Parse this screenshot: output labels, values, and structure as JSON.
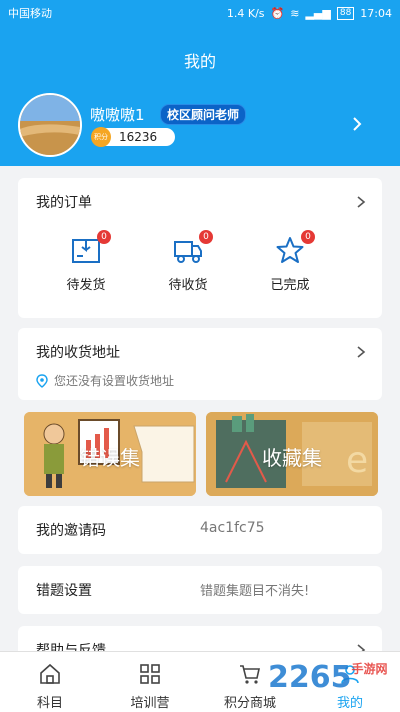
{
  "status_bar": {
    "carrier": "中国移动",
    "speed": "1.4 K/s",
    "battery": "88",
    "time": "17:04"
  },
  "header": {
    "title": "我的",
    "username": "嗷嗷嗷1",
    "role": "校区顾问老师",
    "points_icon_label": "积分",
    "points": "16236"
  },
  "orders": {
    "title": "我的订单",
    "items": [
      {
        "label": "待发货",
        "count": "0",
        "icon": "package-icon"
      },
      {
        "label": "待收货",
        "count": "0",
        "icon": "truck-icon"
      },
      {
        "label": "已完成",
        "count": "0",
        "icon": "star-icon"
      }
    ]
  },
  "address": {
    "title": "我的收货地址",
    "hint": "您还没有设置收货地址"
  },
  "tiles": [
    {
      "label": "错误集",
      "color": "#e8b86a"
    },
    {
      "label": "收藏集",
      "color": "#d9a95a"
    }
  ],
  "invite": {
    "label": "我的邀请码",
    "value": "4ac1fc75"
  },
  "mistake_settings": {
    "label": "错题设置",
    "value": "错题集题目不消失!"
  },
  "help": {
    "label": "帮助与反馈"
  },
  "tabbar": {
    "tabs": [
      {
        "label": "科目",
        "icon": "home-icon"
      },
      {
        "label": "培训营",
        "icon": "grid-icon"
      },
      {
        "label": "积分商城",
        "icon": "cart-icon"
      },
      {
        "label": "我的",
        "icon": "user-icon",
        "active": true
      }
    ]
  },
  "watermark": {
    "number": "2265",
    "site": "手游网"
  },
  "colors": {
    "primary": "#1aa3f0",
    "badge": "#e53935",
    "coin": "#f5a623"
  }
}
